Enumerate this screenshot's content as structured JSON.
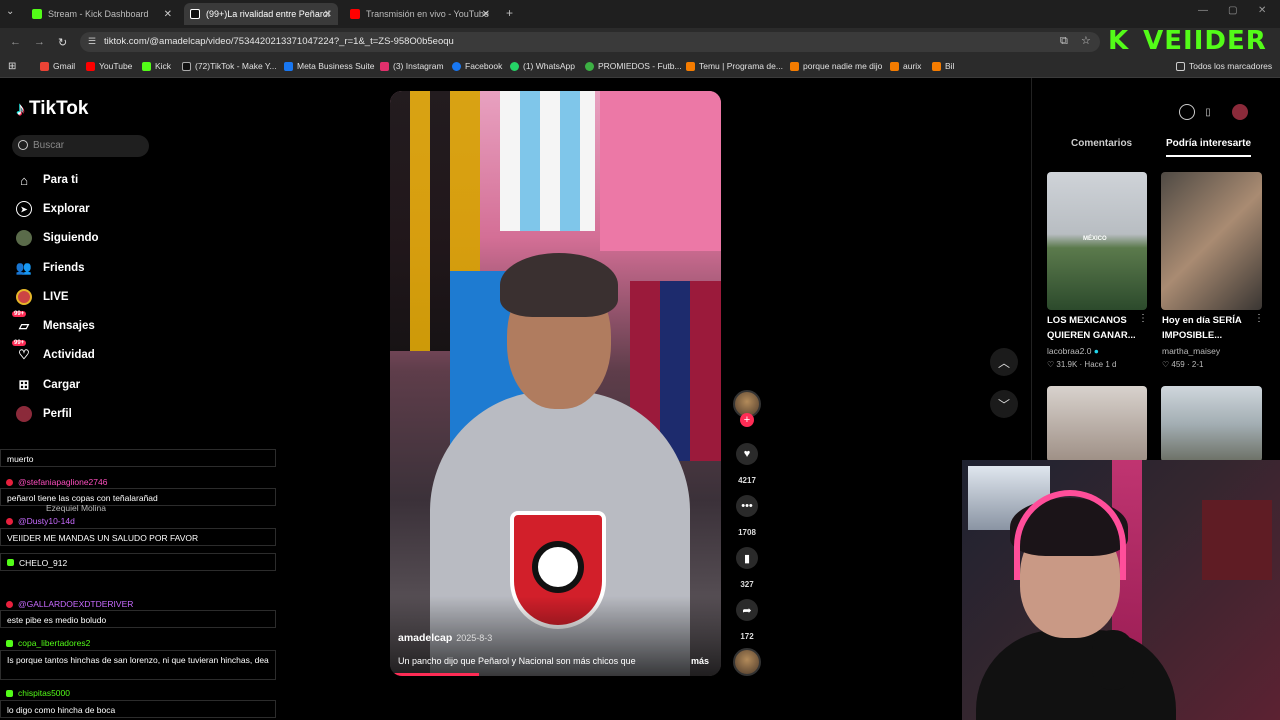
{
  "browser": {
    "tabs": [
      {
        "label": "Stream - Kick Dashboard",
        "color": "#53fc18"
      },
      {
        "label": "(99+)La rivalidad entre Peñarol",
        "color": "#ffffff"
      },
      {
        "label": "Transmisión en vivo - YouTube",
        "color": "#ff0000"
      }
    ],
    "url": "tiktok.com/@amadelcap/video/7534420213371047224?_r=1&_t=ZS-958O0b5eoqu",
    "bookmarks": [
      {
        "label": "Gmail",
        "color": "#ea4335"
      },
      {
        "label": "YouTube",
        "color": "#ff0000"
      },
      {
        "label": "Kick",
        "color": "#53fc18"
      },
      {
        "label": "(72)TikTok - Make Y...",
        "color": "#ffffff"
      },
      {
        "label": "Meta Business Suite",
        "color": "#1877f2"
      },
      {
        "label": "(3) Instagram",
        "color": "#e1306c"
      },
      {
        "label": "Facebook",
        "color": "#1877f2"
      },
      {
        "label": "(1) WhatsApp",
        "color": "#25d366"
      },
      {
        "label": "PROMIEDOS - Futb...",
        "color": "#3cb043"
      },
      {
        "label": "Temu | Programa de...",
        "color": "#f57c00"
      },
      {
        "label": "porque nadie me dijo",
        "color": "#f57c00"
      },
      {
        "label": "aurix",
        "color": "#f57c00"
      },
      {
        "label": "Bil",
        "color": "#f57c00"
      }
    ],
    "bookmarks_folder": "Todos los marcadores"
  },
  "overlay_brand": {
    "k": "K",
    "name": "VEIIDER"
  },
  "tiktok": {
    "logo": "TikTok",
    "search_placeholder": "Buscar",
    "nav": [
      {
        "label": "Para ti",
        "icon": "home-icon"
      },
      {
        "label": "Explorar",
        "icon": "compass-icon"
      },
      {
        "label": "Siguiendo",
        "icon": "following-icon"
      },
      {
        "label": "Friends",
        "icon": "friends-icon"
      },
      {
        "label": "LIVE",
        "icon": "live-icon"
      },
      {
        "label": "Mensajes",
        "icon": "messages-icon",
        "badge": "99+"
      },
      {
        "label": "Actividad",
        "icon": "activity-icon",
        "badge": "99+"
      },
      {
        "label": "Cargar",
        "icon": "upload-icon"
      },
      {
        "label": "Perfil",
        "icon": "profile-icon"
      }
    ],
    "video": {
      "username": "amadelcap",
      "date": "2025-8-3",
      "description": "Un pancho dijo que Peñarol y Nacional son más chicos que",
      "more": "más",
      "progress": 0.27
    },
    "actions": {
      "likes": "4217",
      "comments": "1708",
      "saves": "327",
      "shares": "172"
    },
    "panel_tabs": {
      "comments": "Comentarios",
      "recommended": "Podría interesarte"
    },
    "cards": [
      {
        "title": "LOS MEXICANOS QUIEREN GANAR...",
        "user": "lacobraa2.0",
        "stats": "31.9K · Hace 1 d"
      },
      {
        "title": "Hoy en día SERÍA IMPOSIBLE...",
        "user": "martha_maisey",
        "stats": "459 · 2-1"
      }
    ],
    "thumb_caption": "MÉXICO"
  },
  "chat": [
    {
      "type": "msg",
      "text": "muerto"
    },
    {
      "type": "user",
      "text": "@stefaniapaglione2746",
      "color": "#ff4fbf"
    },
    {
      "type": "msg",
      "text": "peñarol tiene las copas con teñalarañad"
    },
    {
      "type": "user",
      "text": "Ezequiel Molina",
      "color": "#bbbbbb"
    },
    {
      "type": "user",
      "text": "@Dusty10-14d",
      "color": "#c86bff"
    },
    {
      "type": "msg",
      "text": "VEIIDER ME MANDAS UN SALUDO POR FAVOR"
    },
    {
      "type": "user",
      "text": "CHELO_912",
      "color": "#ffffff"
    },
    {
      "type": "user",
      "text": "@GALLARDOEXDTDERIVER",
      "color": "#c86bff"
    },
    {
      "type": "msg",
      "text": "este pibe es medio boludo"
    },
    {
      "type": "user",
      "text": "copa_libertadores2",
      "color": "#53fc18"
    },
    {
      "type": "msg",
      "text": "Is porque tantos hinchas de san lorenzo, ni que tuvieran hinchas, dea"
    },
    {
      "type": "user",
      "text": "chispitas5000",
      "color": "#53fc18"
    },
    {
      "type": "msg",
      "text": "lo digo como hincha de boca"
    }
  ]
}
